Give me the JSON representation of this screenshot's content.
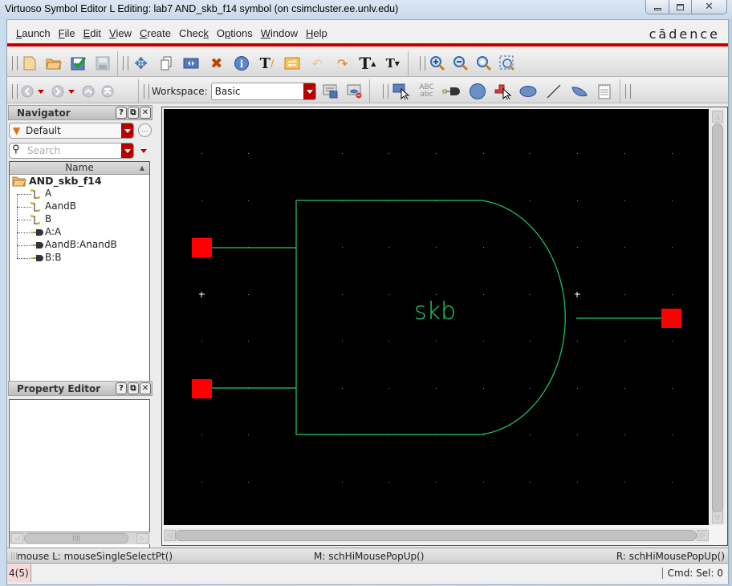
{
  "window": {
    "title": "Virtuoso Symbol Editor L Editing: lab7 AND_skb_f14 symbol (on csimcluster.ee.unlv.edu)",
    "controls": [
      "minimize",
      "maximize",
      "close"
    ]
  },
  "menubar": {
    "items": [
      {
        "label": "Launch",
        "mnemonic": "L"
      },
      {
        "label": "File",
        "mnemonic": "F"
      },
      {
        "label": "Edit",
        "mnemonic": "E"
      },
      {
        "label": "View",
        "mnemonic": "V"
      },
      {
        "label": "Create",
        "mnemonic": "C"
      },
      {
        "label": "Check",
        "mnemonic": "k"
      },
      {
        "label": "Options",
        "mnemonic": "p"
      },
      {
        "label": "Window",
        "mnemonic": "W"
      },
      {
        "label": "Help",
        "mnemonic": "H"
      }
    ],
    "brand": "cādence",
    "accent_color": "#c80000"
  },
  "toolbar1": {
    "file_icons": [
      "new-icon",
      "open-icon",
      "check-save-icon",
      "save-icon"
    ],
    "edit_icons": [
      "move-icon",
      "copy-icon",
      "stretch-icon",
      "delete-icon",
      "properties-icon",
      "text-edit-icon",
      "rotate-icon",
      "undo-icon",
      "redo-icon",
      "larger-text-icon",
      "smaller-text-icon"
    ],
    "zoom_icons": [
      "zoom-in-icon",
      "zoom-out-icon",
      "zoom-fit-icon",
      "zoom-area-icon"
    ]
  },
  "toolbar2": {
    "nav_icons": [
      "back-icon",
      "forward-icon",
      "up-icon",
      "top-icon"
    ],
    "workspace_label": "Workspace:",
    "workspace_value": "Basic",
    "workspace_icons": [
      "save-workspace-icon",
      "delete-workspace-icon"
    ],
    "create_icons": [
      "select-icon",
      "label-icon",
      "pin-icon",
      "circle-icon",
      "selection-box-icon",
      "ellipse-icon",
      "line-icon",
      "arc-icon",
      "notes-icon"
    ]
  },
  "navigator": {
    "title": "Navigator",
    "filter_value": "Default",
    "search_placeholder": "Search",
    "column_header": "Name",
    "root": "AND_skb_f14",
    "items": [
      {
        "label": "A",
        "type": "net"
      },
      {
        "label": "AandB",
        "type": "net"
      },
      {
        "label": "B",
        "type": "net"
      },
      {
        "label": "A:A",
        "type": "pin"
      },
      {
        "label": "AandB:AnandB",
        "type": "pin"
      },
      {
        "label": "B:B",
        "type": "pin"
      }
    ]
  },
  "property_editor": {
    "title": "Property Editor"
  },
  "canvas": {
    "symbol_label": "skb",
    "pins": [
      "A",
      "B",
      "AandB"
    ],
    "pin_color": "#ff0000",
    "shape_color": "#22cc66",
    "background": "#000000"
  },
  "status": {
    "mouse_left": "mouse L: mouseSingleSelectPt()",
    "mouse_middle": "M: schHiMousePopUp()",
    "mouse_right": "R: schHiMousePopUp()",
    "command_count": "4(5)",
    "cmd_sel": "Cmd: Sel: 0"
  }
}
